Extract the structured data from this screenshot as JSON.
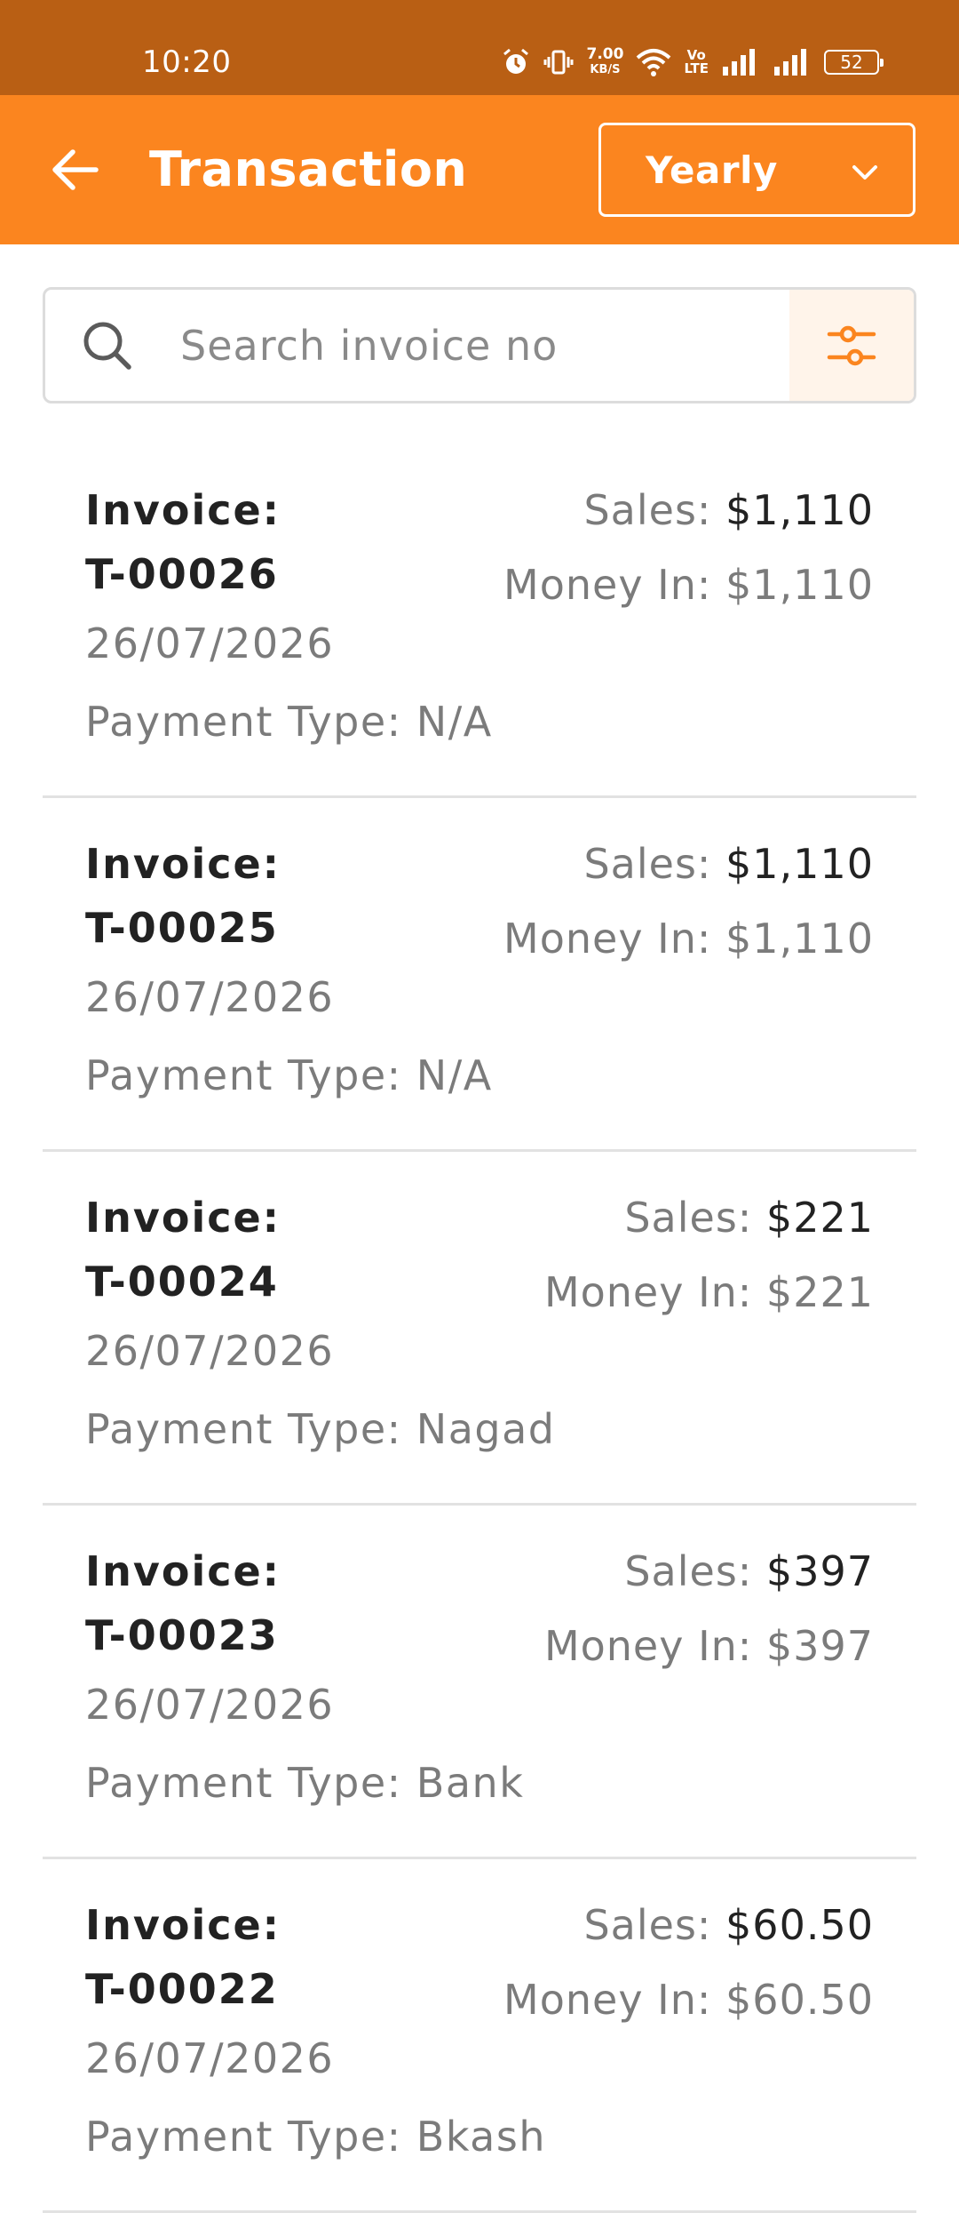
{
  "status_bar": {
    "time": "10:20",
    "net_speed_value": "7.00",
    "net_speed_unit": "KB/S",
    "volte_top": "Vo",
    "volte_bottom": "LTE",
    "battery": "52"
  },
  "app_bar": {
    "title": "Transaction",
    "period": "Yearly"
  },
  "search": {
    "placeholder": "Search invoice no",
    "value": ""
  },
  "labels": {
    "invoice": "Invoice:",
    "sales": "Sales:",
    "money_in": "Money In:",
    "payment_type": "Payment Type:"
  },
  "transactions": [
    {
      "invoice_no": "T-00026",
      "date": "26/07/2026",
      "payment_type": "N/A",
      "sales": "$1,110",
      "money_in": "$1,110"
    },
    {
      "invoice_no": "T-00025",
      "date": "26/07/2026",
      "payment_type": "N/A",
      "sales": "$1,110",
      "money_in": "$1,110"
    },
    {
      "invoice_no": "T-00024",
      "date": "26/07/2026",
      "payment_type": "Nagad",
      "sales": "$221",
      "money_in": "$221"
    },
    {
      "invoice_no": "T-00023",
      "date": "26/07/2026",
      "payment_type": "Bank",
      "sales": "$397",
      "money_in": "$397"
    },
    {
      "invoice_no": "T-00022",
      "date": "26/07/2026",
      "payment_type": "Bkash",
      "sales": "$60.50",
      "money_in": "$60.50"
    }
  ],
  "colors": {
    "status_bar": "#b95f14",
    "app_bar": "#fb851f",
    "filter_bg": "#fff4ea",
    "accent": "#fb851f"
  },
  "icons": {
    "back": "arrow-left-icon",
    "dropdown": "chevron-down-icon",
    "search": "search-icon",
    "filter": "sliders-icon"
  }
}
